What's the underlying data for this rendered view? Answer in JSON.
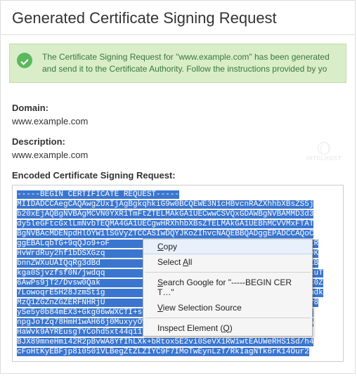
{
  "header": {
    "title": "Generated Certificate Signing Request"
  },
  "alert": {
    "text": "The Certificate Signing Request for \"www.example.com\" has been generated and send it to the Certificate Authority. Follow the instructions provided by yo"
  },
  "fields": {
    "domain_label": "Domain:",
    "domain_value": "www.example.com",
    "description_label": "Description:",
    "description_value": "www.example.com",
    "csr_label": "Encoded Certificate Signing Request:"
  },
  "watermark": "INTELHOST",
  "csr_lines": [
    "-----BEGIN CERTIFICATE REQUEST-----",
    "MIIDADCCAegCAQAwgZUxIjAgBgkqhkiG9w0BCQEWE3N1cHBvcnRAZXhhbXBsZS5j",
    "b20xEjAQBgNVBAgMCVN0YXR1TmFtZTELMAkGA1UECwwCSVQxGDAWBgNVBAMMD3d3",
    "dy5leGFtcGxlLmNvbTEQMA4GA1UECgwHRXhhbXBsZTELMAkGA1UEBhMCVVMxFTAT",
    "BgNVBAcMDENpdHlOYW1lSGVyZTCCASIwDQYJKoZIhvcNAQEBBQADggEPADCCAQoC",
    "ggEBALqbTG+9qQJo9+oF                                       og/5kR",
    "HvWrdRuy2hf1bDSXGzq                                        TGH+9K",
    "bnnZWXuUAIQqRg3dBd                                         kMNyZB",
    "kga0Sjvzfsf0N/jwdqq                                        Bh2RzuT",
    "6AwPs9jT2/Dvsw0Qak                                         d3L2C0Z",
    "7LowoqrE5H28JzmSt1g                                        BRkZmdk",
    "MzQ1ZGZnZGZERFNHRjU                                        IbM4y8",
    "ySe5y0b84mEX3+Gkg06wWXCTI+sGI4SInJekQpPZ6gMYjEbKHtoobmjfcCoBSNDr",
    "npgJoTZq78HmH1wAH66j0MuxyyOW/SwJ7I2yJVrF4uwNYMsPI41JTqZH0x2EJ4IA",
    "HaWvk9AYREusgTYCohd5xt44q119SOCgv2LyAML9pFhrRNd4psf94e+QnYATB3D",
    "BJX89mneHmi42R2pBvWA8YfIhLXk+bRtox5E2vi0SeVX1RW1wtEAUWeRHS1Sd/h4",
    "cFoHtKyEBFjp8i0501VLBegZtZLZIYC9F7IMoTwEynLzT/RkIagNTk6rK14Our2"
  ],
  "context_menu": {
    "copy": "Copy",
    "select_all": "Select All",
    "search": "Search Google for \"-----BEGIN CERT…\"",
    "view_source": "View Selection Source",
    "inspect": "Inspect Element (Q)"
  }
}
